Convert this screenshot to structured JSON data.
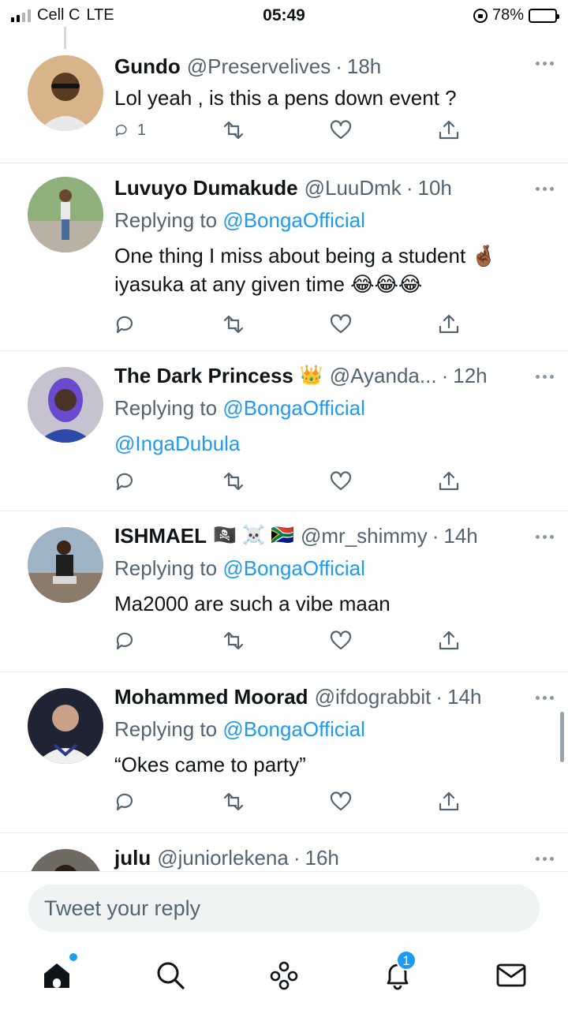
{
  "status_bar": {
    "carrier": "Cell C",
    "network": "LTE",
    "time": "05:49",
    "battery": "78%",
    "battery_level": 0.78
  },
  "tweets": [
    {
      "name": "Gundo",
      "handle": "@Preservelives",
      "time": "18h",
      "replying_prefix": "",
      "replying_to": "",
      "text": "Lol yeah , is this a pens down event ?",
      "reply_count": "1",
      "avatar_color": "#c9a27a"
    },
    {
      "name": "Luvuyo Dumakude",
      "handle": "@LuuDmk",
      "time": "10h",
      "replying_prefix": "Replying to ",
      "replying_to": "@BongaOfficial",
      "text": "One thing I miss about being a student 🤞🏾 iyasuka at any given time 😂😂😂",
      "reply_count": "",
      "avatar_color": "#6d8a4a"
    },
    {
      "name": "The Dark Princess",
      "name_emoji": "👑",
      "handle": "@Ayanda...",
      "time": "12h",
      "replying_prefix": "Replying to ",
      "replying_to": "@BongaOfficial",
      "text": "@IngaDubula",
      "reply_count": "",
      "avatar_color": "#5a4fb0"
    },
    {
      "name": "ISHMAEL",
      "name_emoji": "🏴‍☠️ ☠️ 🇿🇦",
      "handle": "@mr_shimmy",
      "time": "14h",
      "replying_prefix": "Replying to ",
      "replying_to": "@BongaOfficial",
      "text": "Ma2000 are such a vibe maan",
      "reply_count": "",
      "avatar_color": "#3b5f8a"
    },
    {
      "name": "Mohammed Moorad",
      "handle": "@ifdograbbit",
      "time": "14h",
      "replying_prefix": "Replying to ",
      "replying_to": "@BongaOfficial",
      "text": "“Okes came to party”",
      "reply_count": "",
      "avatar_color": "#2a3a66"
    },
    {
      "name": "julu",
      "handle": "@juniorlekena",
      "time": "16h",
      "avatar_color": "#4a4a4a"
    }
  ],
  "reply_box": {
    "placeholder": "Tweet your reply"
  },
  "tab_bar": {
    "notifications_count": "1"
  },
  "colors": {
    "accent": "#1d9bf0",
    "secondary_text": "#536471",
    "divider": "#e6ecf0"
  }
}
